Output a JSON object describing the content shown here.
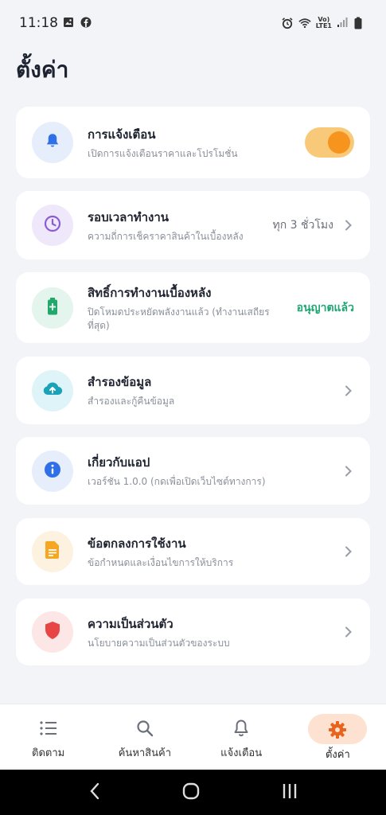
{
  "status_bar": {
    "time": "11:18",
    "lte_top": "Vo)",
    "lte_bottom": "LTE1"
  },
  "page": {
    "title": "ตั้งค่า"
  },
  "settings": [
    {
      "title": "การแจ้งเตือน",
      "subtitle": "เปิดการแจ้งเตือนราคาและโปรโมชั่น",
      "icon": "bell-icon",
      "icon_color": "#2f6fe8",
      "icon_bg": "#e6eefc",
      "toggle_on": true
    },
    {
      "title": "รอบเวลาทำงาน",
      "subtitle": "ความถี่การเช็คราคาสินค้าในเบื้องหลัง",
      "value": "ทุก 3 ชั่วโมง",
      "icon": "clock-icon",
      "icon_color": "#8b5cd6",
      "icon_bg": "#efe8fb"
    },
    {
      "title": "สิทธิ์การทำงานเบื้องหลัง",
      "subtitle": "ปิดโหมดประหยัดพลังงานแล้ว (ทำงานเสถียรที่สุด)",
      "value": "อนุญาตแล้ว",
      "icon": "battery-icon",
      "icon_color": "#21a86a",
      "icon_bg": "#e3f5ec"
    },
    {
      "title": "สำรองข้อมูล",
      "subtitle": "สำรองและกู้คืนข้อมูล",
      "icon": "cloud-upload-icon",
      "icon_color": "#1aa3b8",
      "icon_bg": "#dff4f8"
    },
    {
      "title": "เกี่ยวกับแอป",
      "subtitle": "เวอร์ชัน 1.0.0 (กดเพื่อเปิดเว็บไซต์ทางการ)",
      "icon": "info-icon",
      "icon_color": "#2f6fe8",
      "icon_bg": "#e6eefc"
    },
    {
      "title": "ข้อตกลงการใช้งาน",
      "subtitle": "ข้อกำหนดและเงื่อนไขการให้บริการ",
      "icon": "document-icon",
      "icon_color": "#f5a623",
      "icon_bg": "#fdf1e0"
    },
    {
      "title": "ความเป็นส่วนตัว",
      "subtitle": "นโยบายความเป็นส่วนตัวของระบบ",
      "icon": "shield-icon",
      "icon_color": "#e84545",
      "icon_bg": "#fde6e6"
    }
  ],
  "bottom_nav": [
    {
      "label": "ติดตาม",
      "icon": "list-icon"
    },
    {
      "label": "ค้นหาสินค้า",
      "icon": "search-icon"
    },
    {
      "label": "แจ้งเตือน",
      "icon": "bell-icon"
    },
    {
      "label": "ตั้งค่า",
      "icon": "gear-icon",
      "active": true
    }
  ],
  "colors": {
    "accent": "#f7941d",
    "background": "#f3f4f8",
    "success": "#1fa672"
  }
}
